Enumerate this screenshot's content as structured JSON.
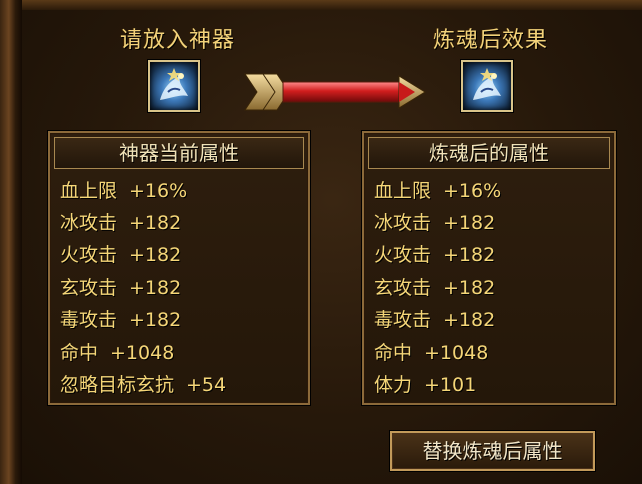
{
  "left_slot": {
    "title": "请放入神器",
    "icon": "artifact-creature-icon"
  },
  "right_slot": {
    "title": "炼魂后效果",
    "icon": "artifact-creature-icon"
  },
  "arrow_icon": "red-arrow-icon",
  "current_panel": {
    "header": "神器当前属性",
    "rows": [
      {
        "name": "血上限",
        "value": "+16%"
      },
      {
        "name": "冰攻击",
        "value": "+182"
      },
      {
        "name": "火攻击",
        "value": "+182"
      },
      {
        "name": "玄攻击",
        "value": "+182"
      },
      {
        "name": "毒攻击",
        "value": "+182"
      },
      {
        "name": "命中",
        "value": "+1048"
      },
      {
        "name": "忽略目标玄抗",
        "value": "+54"
      }
    ]
  },
  "result_panel": {
    "header": "炼魂后的属性",
    "rows": [
      {
        "name": "血上限",
        "value": "+16%"
      },
      {
        "name": "冰攻击",
        "value": "+182"
      },
      {
        "name": "火攻击",
        "value": "+182"
      },
      {
        "name": "玄攻击",
        "value": "+182"
      },
      {
        "name": "毒攻击",
        "value": "+182"
      },
      {
        "name": "命中",
        "value": "+1048"
      },
      {
        "name": "体力",
        "value": "+101"
      }
    ]
  },
  "replace_button": {
    "label": "替换炼魂后属性"
  },
  "colors": {
    "text_gold": "#f5d678",
    "title_gold": "#f2d27a",
    "border": "#8c6a3a",
    "arrow_red": "#c81a1a"
  }
}
